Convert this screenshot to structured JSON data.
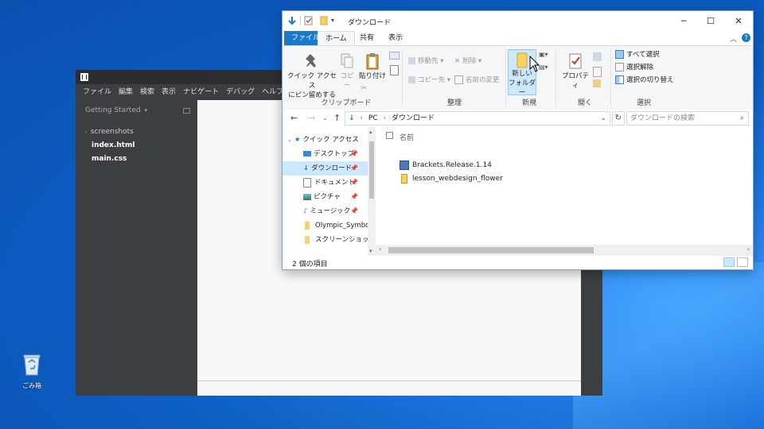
{
  "desktop": {
    "recycle_bin_label": "ごみ箱"
  },
  "brackets": {
    "menu": [
      "ファイル",
      "編集",
      "検索",
      "表示",
      "ナビゲート",
      "デバッグ",
      "ヘルプ"
    ],
    "working_set_title": "Getting Started",
    "working_set_caret": "▾",
    "files": [
      {
        "name": "screenshots",
        "type": "folder"
      },
      {
        "name": "index.html",
        "type": "file"
      },
      {
        "name": "main.css",
        "type": "file"
      }
    ]
  },
  "explorer": {
    "title": "ダウンロード",
    "tabs": {
      "file": "ファイル",
      "home": "ホーム",
      "share": "共有",
      "view": "表示"
    },
    "ribbon": {
      "pin_quick_access": "クイック アクセス\nにピン留めする",
      "copy": "コピー",
      "paste": "貼り付け",
      "move_to": "移動先",
      "copy_to": "コピー先",
      "delete": "削除",
      "rename": "名前の変更",
      "new_folder": "新しい\nフォルダー",
      "properties": "プロパティ",
      "select_all": "すべて選択",
      "select_none": "選択解除",
      "invert_selection": "選択の切り替え",
      "groups": {
        "clipboard": "クリップボード",
        "organize": "整理",
        "new": "新規",
        "open": "開く",
        "select": "選択"
      }
    },
    "address": {
      "pc": "PC",
      "separator": "›",
      "folder": "ダウンロード"
    },
    "search_placeholder": "ダウンロードの検索",
    "nav_items": [
      {
        "label": "クイック アクセス",
        "icon": "star-icon",
        "pinned": false
      },
      {
        "label": "デスクトップ",
        "icon": "desktop-icon",
        "pinned": true
      },
      {
        "label": "ダウンロード",
        "icon": "download-icon",
        "pinned": true,
        "selected": true
      },
      {
        "label": "ドキュメント",
        "icon": "document-icon",
        "pinned": true
      },
      {
        "label": "ピクチャ",
        "icon": "picture-icon",
        "pinned": true
      },
      {
        "label": "ミュージック",
        "icon": "music-icon",
        "pinned": true
      },
      {
        "label": "Olympic_Symbo",
        "icon": "folder-icon",
        "pinned": false
      },
      {
        "label": "スクリーンショット",
        "icon": "folder-icon",
        "pinned": false
      }
    ],
    "column_name": "名前",
    "files": [
      {
        "name": "Brackets.Release.1.14",
        "icon": "installer-icon"
      },
      {
        "name": "lesson_webdesign_flower",
        "icon": "zip-folder-icon"
      }
    ],
    "status": "2 個の項目"
  },
  "colors": {
    "accent": "#1979ca",
    "selection": "#cce8ff",
    "brackets_bg": "#3c3f41"
  }
}
